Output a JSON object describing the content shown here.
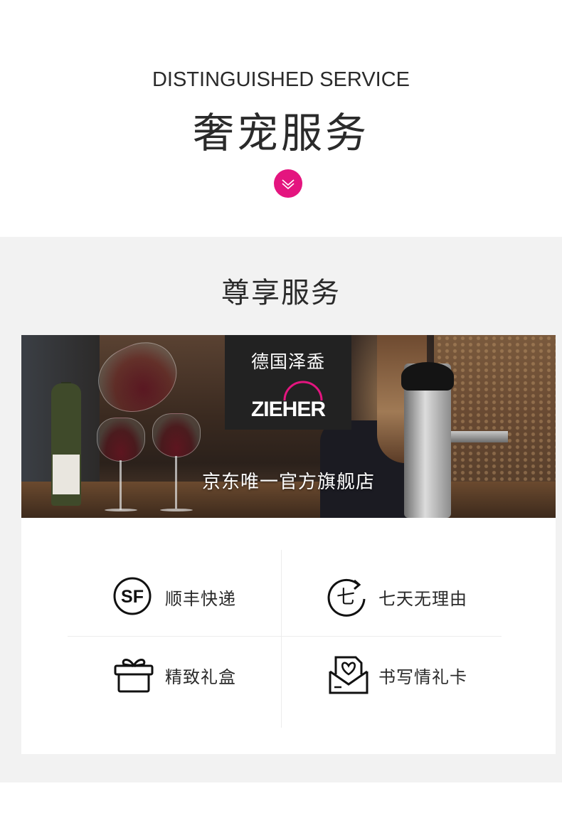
{
  "header": {
    "title_en": "DISTINGUISHED SERVICE",
    "title_cn": "奢宠服务",
    "accent_color": "#e4157f",
    "scroll_icon": "chevron-down-icon"
  },
  "section": {
    "title": "尊享服务"
  },
  "banner": {
    "brand_cn": "德国泽盉",
    "brand_en": "ZIEHER",
    "slogan": "京东唯一官方旗舰店"
  },
  "services": [
    {
      "icon": "sf-express-icon",
      "label": "顺丰快递"
    },
    {
      "icon": "seven-day-return-icon",
      "label": "七天无理由"
    },
    {
      "icon": "gift-box-icon",
      "label": "精致礼盒"
    },
    {
      "icon": "greeting-card-icon",
      "label": "书写情礼卡"
    }
  ]
}
